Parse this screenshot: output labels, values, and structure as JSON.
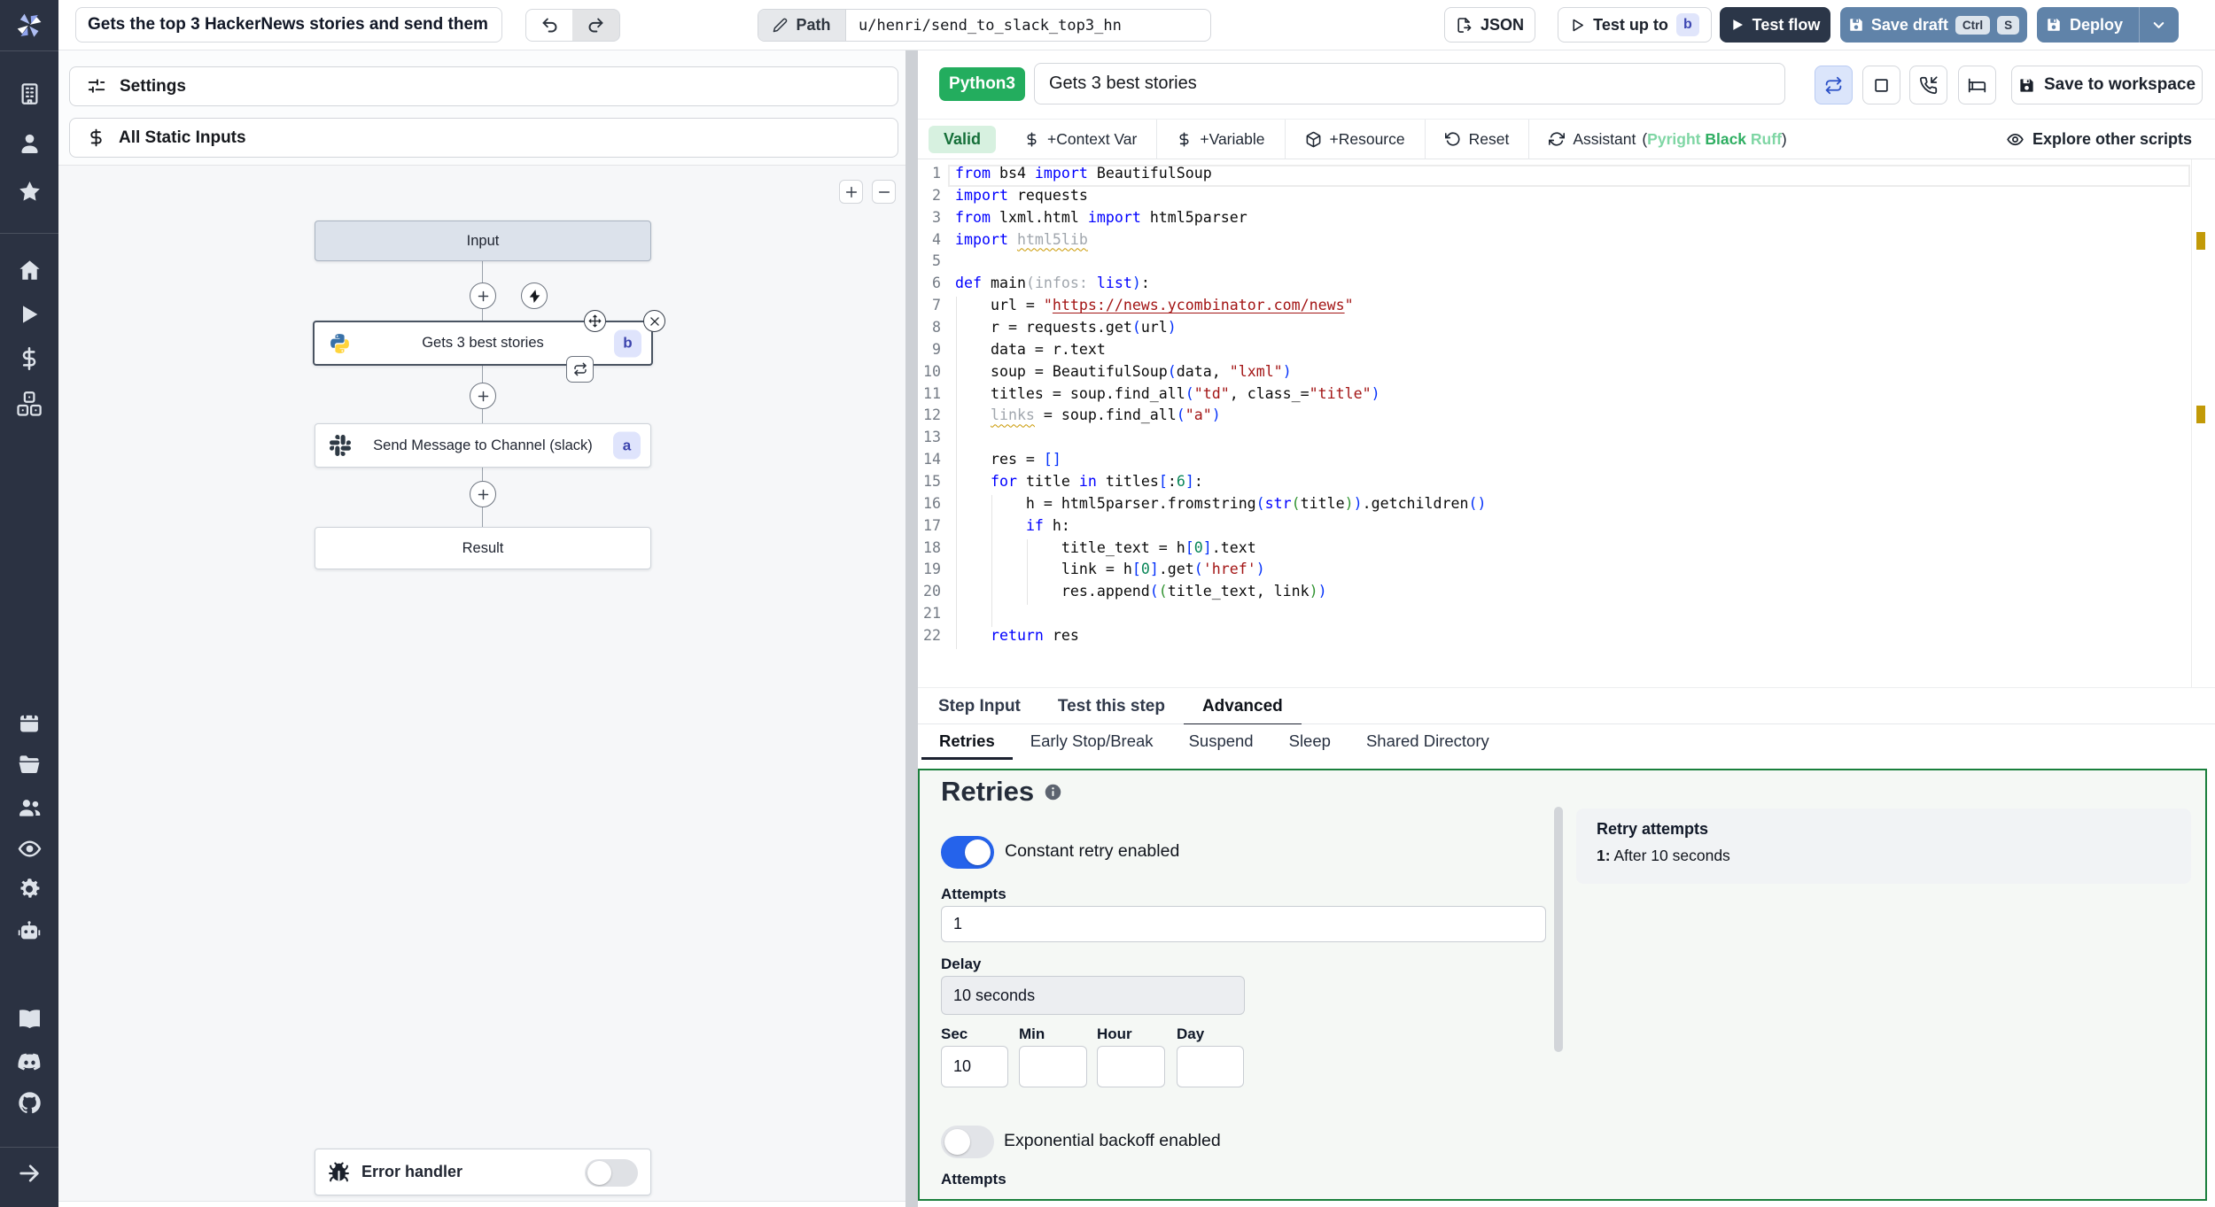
{
  "topbar": {
    "flow_title": "Gets the top 3 HackerNews stories and send them",
    "path_label": "Path",
    "path_value": "u/henri/send_to_slack_top3_hn",
    "json_button": "JSON",
    "test_up_to": "Test up to",
    "test_up_to_badge": "b",
    "test_flow": "Test flow",
    "save_draft": "Save draft",
    "kbd_ctrl": "Ctrl",
    "kbd_s": "S",
    "deploy": "Deploy"
  },
  "flow_panel": {
    "settings": "Settings",
    "all_static_inputs": "All Static Inputs",
    "zoom_in": "+",
    "zoom_out": "−",
    "input_node": "Input",
    "step_b_label": "Gets 3 best stories",
    "step_b_badge": "b",
    "step_a_label": "Send Message to Channel (slack)",
    "step_a_badge": "a",
    "result_node": "Result",
    "error_handler": "Error handler"
  },
  "editor": {
    "language_badge": "Python3",
    "title_value": "Gets 3 best stories",
    "save_to_workspace": "Save to workspace",
    "valid_badge": "Valid",
    "context_var": "+Context Var",
    "variable": "+Variable",
    "resource": "+Resource",
    "reset": "Reset",
    "assistant": "Assistant",
    "assistant_detail_open": "(",
    "assistant_pyright": "Pyright",
    "assistant_black": "Black",
    "assistant_ruff": "Ruff",
    "assistant_detail_close": ")",
    "explore_other_scripts": "Explore other scripts",
    "code": {
      "lines": [
        {
          "n": "1",
          "guides": [],
          "tokens": [
            [
              "kw",
              "from"
            ],
            [
              "pl",
              " bs4 "
            ],
            [
              "kw",
              "import"
            ],
            [
              "pl",
              " BeautifulSoup"
            ]
          ]
        },
        {
          "n": "2",
          "guides": [],
          "tokens": [
            [
              "kw",
              "import"
            ],
            [
              "pl",
              " requests"
            ]
          ]
        },
        {
          "n": "3",
          "guides": [],
          "tokens": [
            [
              "kw",
              "from"
            ],
            [
              "pl",
              " lxml.html "
            ],
            [
              "kw",
              "import"
            ],
            [
              "pl",
              " html5parser"
            ]
          ]
        },
        {
          "n": "4",
          "guides": [],
          "tokens": [
            [
              "kw",
              "import"
            ],
            [
              "pl",
              " "
            ],
            [
              "fade sq",
              "html5lib"
            ]
          ]
        },
        {
          "n": "5",
          "guides": [],
          "tokens": []
        },
        {
          "n": "6",
          "guides": [],
          "tokens": [
            [
              "kw",
              "def"
            ],
            [
              "pl",
              " main"
            ],
            [
              "fade",
              "("
            ],
            [
              "fade",
              "infos"
            ],
            [
              "fade",
              ":"
            ],
            [
              "pl",
              " "
            ],
            [
              "kw",
              "list"
            ],
            [
              "b1",
              ")"
            ],
            [
              "pl",
              ":"
            ]
          ]
        },
        {
          "n": "7",
          "guides": [
            0
          ],
          "tokens": [
            [
              "pl",
              "    url = "
            ],
            [
              "str",
              "\""
            ],
            [
              "url",
              "https://news.ycombinator.com/news"
            ],
            [
              "str",
              "\""
            ]
          ]
        },
        {
          "n": "8",
          "guides": [
            0
          ],
          "tokens": [
            [
              "pl",
              "    r = requests.get"
            ],
            [
              "b1",
              "("
            ],
            [
              "pl",
              "url"
            ],
            [
              "b1",
              ")"
            ]
          ]
        },
        {
          "n": "9",
          "guides": [
            0
          ],
          "tokens": [
            [
              "pl",
              "    data = r.text"
            ]
          ]
        },
        {
          "n": "10",
          "guides": [
            0
          ],
          "tokens": [
            [
              "pl",
              "    soup = BeautifulSoup"
            ],
            [
              "b1",
              "("
            ],
            [
              "pl",
              "data, "
            ],
            [
              "str",
              "\"lxml\""
            ],
            [
              "b1",
              ")"
            ]
          ]
        },
        {
          "n": "11",
          "guides": [
            0
          ],
          "tokens": [
            [
              "pl",
              "    titles = soup.find_all"
            ],
            [
              "b1",
              "("
            ],
            [
              "str",
              "\"td\""
            ],
            [
              "pl",
              ", class_="
            ],
            [
              "str",
              "\"title\""
            ],
            [
              "b1",
              ")"
            ]
          ]
        },
        {
          "n": "12",
          "guides": [
            0
          ],
          "tokens": [
            [
              "pl",
              "    "
            ],
            [
              "fade sq",
              "links"
            ],
            [
              "pl",
              " = soup.find_all"
            ],
            [
              "b1",
              "("
            ],
            [
              "str",
              "\"a\""
            ],
            [
              "b1",
              ")"
            ]
          ]
        },
        {
          "n": "13",
          "guides": [
            0
          ],
          "tokens": []
        },
        {
          "n": "14",
          "guides": [
            0
          ],
          "tokens": [
            [
              "pl",
              "    res = "
            ],
            [
              "b1",
              "[]"
            ]
          ]
        },
        {
          "n": "15",
          "guides": [
            0
          ],
          "tokens": [
            [
              "pl",
              "    "
            ],
            [
              "kw",
              "for"
            ],
            [
              "pl",
              " title "
            ],
            [
              "kw",
              "in"
            ],
            [
              "pl",
              " titles"
            ],
            [
              "b1",
              "["
            ],
            [
              "pl",
              ":"
            ],
            [
              "num",
              "6"
            ],
            [
              "b1",
              "]"
            ],
            [
              "pl",
              ":"
            ]
          ]
        },
        {
          "n": "16",
          "guides": [
            0,
            4
          ],
          "tokens": [
            [
              "pl",
              "        h = html5parser.fromstring"
            ],
            [
              "b1",
              "("
            ],
            [
              "kw",
              "str"
            ],
            [
              "b2",
              "("
            ],
            [
              "pl",
              "title"
            ],
            [
              "b2",
              ")"
            ],
            [
              "b1",
              ")"
            ],
            [
              "pl",
              ".getchildren"
            ],
            [
              "b1",
              "()"
            ]
          ]
        },
        {
          "n": "17",
          "guides": [
            0,
            4
          ],
          "tokens": [
            [
              "pl",
              "        "
            ],
            [
              "kw",
              "if"
            ],
            [
              "pl",
              " h:"
            ]
          ]
        },
        {
          "n": "18",
          "guides": [
            0,
            4,
            8
          ],
          "tokens": [
            [
              "pl",
              "            title_text = h"
            ],
            [
              "b1",
              "["
            ],
            [
              "num",
              "0"
            ],
            [
              "b1",
              "]"
            ],
            [
              "pl",
              ".text"
            ]
          ]
        },
        {
          "n": "19",
          "guides": [
            0,
            4,
            8
          ],
          "tokens": [
            [
              "pl",
              "            link = h"
            ],
            [
              "b1",
              "["
            ],
            [
              "num",
              "0"
            ],
            [
              "b1",
              "]"
            ],
            [
              "pl",
              ".get"
            ],
            [
              "b1",
              "("
            ],
            [
              "str",
              "'href'"
            ],
            [
              "b1",
              ")"
            ]
          ]
        },
        {
          "n": "20",
          "guides": [
            0,
            4,
            8
          ],
          "tokens": [
            [
              "pl",
              "            res.append"
            ],
            [
              "b1",
              "("
            ],
            [
              "b2",
              "("
            ],
            [
              "pl",
              "title_text, link"
            ],
            [
              "b2",
              ")"
            ],
            [
              "b1",
              ")"
            ]
          ]
        },
        {
          "n": "21",
          "guides": [
            0,
            4
          ],
          "tokens": []
        },
        {
          "n": "22",
          "guides": [
            0
          ],
          "tokens": [
            [
              "pl",
              "    "
            ],
            [
              "kw",
              "return"
            ],
            [
              "pl",
              " res"
            ]
          ]
        }
      ]
    }
  },
  "bottom": {
    "tabs": [
      {
        "label": "Step Input",
        "active": false
      },
      {
        "label": "Test this step",
        "active": false
      },
      {
        "label": "Advanced",
        "active": true
      }
    ],
    "subtabs": [
      {
        "label": "Retries",
        "active": true
      },
      {
        "label": "Early Stop/Break",
        "active": false
      },
      {
        "label": "Suspend",
        "active": false
      },
      {
        "label": "Sleep",
        "active": false
      },
      {
        "label": "Shared Directory",
        "active": false
      }
    ],
    "retries": {
      "heading": "Retries",
      "constant_retry_label": "Constant retry enabled",
      "attempts_label": "Attempts",
      "attempts_value": "1",
      "delay_label": "Delay",
      "delay_value": "10 seconds",
      "sec_label": "Sec",
      "min_label": "Min",
      "hour_label": "Hour",
      "day_label": "Day",
      "sec_value": "10",
      "min_value": "",
      "hour_value": "",
      "day_value": "",
      "exponential_label": "Exponential backoff enabled",
      "attempts2_label": "Attempts",
      "retry_attempts_title": "Retry attempts",
      "retry_attempt_1_num": "1:",
      "retry_attempt_1_text": "After 10 seconds"
    }
  },
  "colors": {
    "accent_green": "#1a7f3c",
    "toggle_blue": "#2563eb",
    "steel_blue": "#6083a9",
    "dark_button": "#2b3648",
    "sidebar_bg": "#2b3242"
  }
}
